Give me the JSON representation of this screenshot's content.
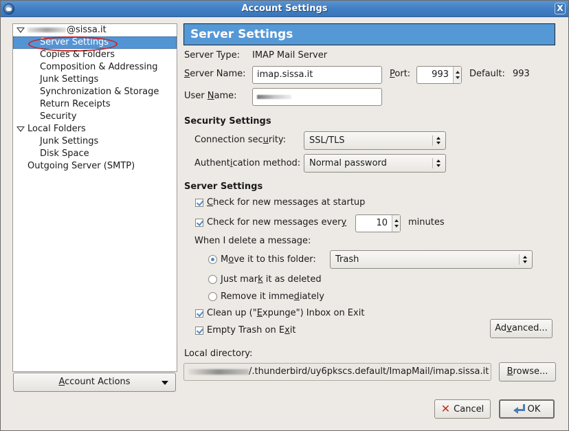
{
  "window": {
    "title": "Account Settings",
    "app_icon": "thunderbird-icon",
    "close_label": "X"
  },
  "tree": {
    "account_suffix": "@sissa.it",
    "items": [
      {
        "label": "Server Settings",
        "selected": true
      },
      {
        "label": "Copies & Folders"
      },
      {
        "label": "Composition & Addressing"
      },
      {
        "label": "Junk Settings"
      },
      {
        "label": "Synchronization & Storage"
      },
      {
        "label": "Return Receipts"
      },
      {
        "label": "Security"
      }
    ],
    "local_folders": {
      "label": "Local Folders",
      "items": [
        {
          "label": "Junk Settings"
        },
        {
          "label": "Disk Space"
        }
      ]
    },
    "outgoing": "Outgoing Server (SMTP)"
  },
  "account_actions": {
    "label_mnemonic": "A",
    "label_rest": "ccount Actions"
  },
  "panel": {
    "header": "Server Settings",
    "server_type_label": "Server Type:",
    "server_type_value": "IMAP Mail Server",
    "server_name_label_m": "S",
    "server_name_label_rest": "erver Name:",
    "server_name_value": "imap.sissa.it",
    "port_label_m": "P",
    "port_label_rest": "ort:",
    "port_value": "993",
    "default_label": "Default:",
    "default_value": "993",
    "user_name_label_a": "User ",
    "user_name_label_m": "N",
    "user_name_label_rest": "ame:",
    "security_heading": "Security Settings",
    "conn_sec_label_a": "Connection sec",
    "conn_sec_label_m": "u",
    "conn_sec_label_rest": "rity:",
    "conn_sec_value": "SSL/TLS",
    "auth_label_a": "Authent",
    "auth_label_m": "i",
    "auth_label_rest": "cation method:",
    "auth_value": "Normal password",
    "server_heading": "Server Settings",
    "check_startup_m": "C",
    "check_startup_rest": "heck for new messages at startup",
    "check_startup_checked": true,
    "check_every_a": "Check for new messages ever",
    "check_every_m": "y",
    "check_every_checked": true,
    "check_every_value": "10",
    "minutes_label": "minutes",
    "delete_label": "When I delete a message:",
    "move_a": "M",
    "move_m": "o",
    "move_rest": "ve it to this folder:",
    "move_selected": true,
    "folder_value": "Trash",
    "mark_a": "Just mar",
    "mark_m": "k",
    "mark_rest": " it as deleted",
    "remove_a": "Remove it imme",
    "remove_m": "d",
    "remove_rest": "iately",
    "cleanup_a": "Clean up (\"",
    "cleanup_m": "E",
    "cleanup_rest": "xpunge\") Inbox on Exit",
    "cleanup_checked": true,
    "empty_a": "Empty Trash on E",
    "empty_m": "x",
    "empty_rest": "it",
    "empty_checked": true,
    "advanced_a": "Ad",
    "advanced_m": "v",
    "advanced_rest": "anced...",
    "local_dir_label": "Local directory:",
    "local_dir_value": "/.thunderbird/uy6pkscs.default/ImapMail/imap.sissa.it",
    "browse_m": "B",
    "browse_rest": "rowse..."
  },
  "footer": {
    "cancel": "Cancel",
    "ok": "OK"
  }
}
